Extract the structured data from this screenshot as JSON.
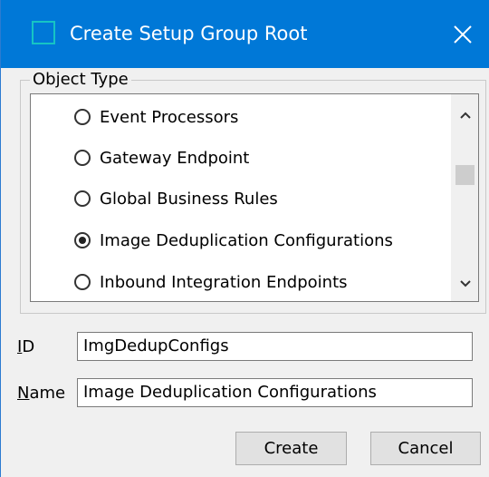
{
  "window": {
    "title": "Create Setup Group Root",
    "icon": "window-app-icon",
    "close_icon": "close-icon"
  },
  "object_type": {
    "legend": "Object Type",
    "items": [
      {
        "label": "Event Processors",
        "selected": false
      },
      {
        "label": "Gateway Endpoint",
        "selected": false
      },
      {
        "label": "Global Business Rules",
        "selected": false
      },
      {
        "label": "Image Deduplication Configurations",
        "selected": true
      },
      {
        "label": "Inbound Integration Endpoints",
        "selected": false
      }
    ],
    "scroll_up_icon": "chevron-up-icon",
    "scroll_down_icon": "chevron-down-icon"
  },
  "form": {
    "id": {
      "mnemonic": "I",
      "label_rest": "D",
      "value": "ImgDedupConfigs"
    },
    "name": {
      "mnemonic": "N",
      "label_rest": "ame",
      "value": "Image Deduplication Configurations"
    }
  },
  "buttons": {
    "create_label": "Create",
    "cancel_label": "Cancel"
  },
  "colors": {
    "titlebar": "#0078d7",
    "icon_accent": "#16c4c4"
  }
}
